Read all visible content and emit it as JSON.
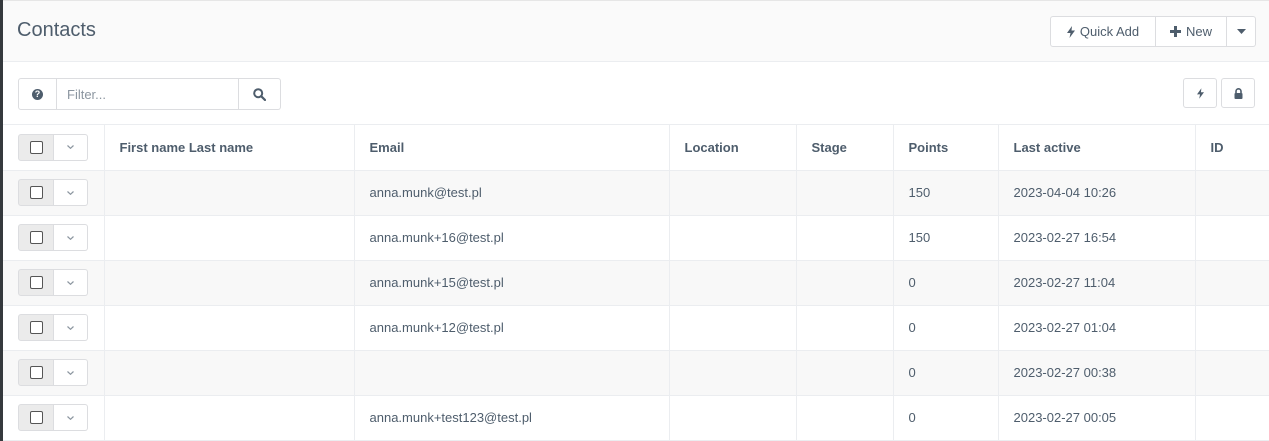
{
  "header": {
    "title": "Contacts",
    "quick_add_label": "Quick Add",
    "new_label": "New"
  },
  "toolbar": {
    "filter_placeholder": "Filter..."
  },
  "table": {
    "columns": [
      "First name Last name",
      "Email",
      "Location",
      "Stage",
      "Points",
      "Last active",
      "ID"
    ],
    "rows": [
      {
        "name": "",
        "email": "anna.munk@test.pl",
        "location": "",
        "stage": "",
        "points": "150",
        "last_active": "2023-04-04 10:26",
        "id": ""
      },
      {
        "name": "",
        "email": "anna.munk+16@test.pl",
        "location": "",
        "stage": "",
        "points": "150",
        "last_active": "2023-02-27 16:54",
        "id": ""
      },
      {
        "name": "",
        "email": "anna.munk+15@test.pl",
        "location": "",
        "stage": "",
        "points": "0",
        "last_active": "2023-02-27 11:04",
        "id": ""
      },
      {
        "name": "",
        "email": "anna.munk+12@test.pl",
        "location": "",
        "stage": "",
        "points": "0",
        "last_active": "2023-02-27 01:04",
        "id": ""
      },
      {
        "name": "",
        "email": "",
        "location": "",
        "stage": "",
        "points": "0",
        "last_active": "2023-02-27 00:38",
        "id": ""
      },
      {
        "name": "",
        "email": "anna.munk+test123@test.pl",
        "location": "",
        "stage": "",
        "points": "0",
        "last_active": "2023-02-27 00:05",
        "id": ""
      }
    ]
  },
  "icons": {
    "quick_add": "bolt-icon",
    "new": "plus-icon",
    "dropdown": "caret-down-icon",
    "help": "question-circle-icon",
    "search": "search-icon",
    "right_bolt": "bolt-icon",
    "right_lock": "lock-icon",
    "row_menu": "chevron-down-icon"
  },
  "colors": {
    "text": "#4e5d6c",
    "border": "#ebedf0",
    "stripe": "#f8f8f8",
    "header_bg": "#fafafa"
  }
}
